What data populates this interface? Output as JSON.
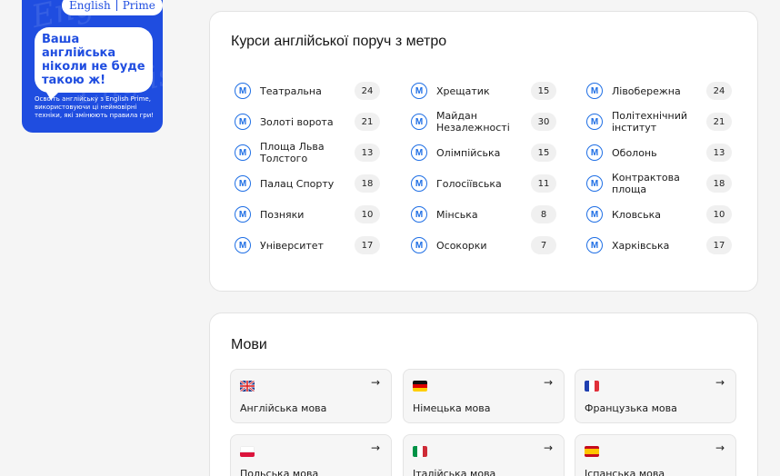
{
  "promo": {
    "logo_left": "English",
    "logo_right": "Prime",
    "headline": "Ваша англійська ніколи не буде такою ж!",
    "subtext": "Освоїть англійську з English Prime, використовуючи ці неймовірні техніки, які змінюють правила гри!",
    "brand_color": "#1f4de0"
  },
  "metro": {
    "title": "Курси англійської поруч з метро",
    "icon_glyph": "M",
    "columns": [
      [
        {
          "name": "Театральна",
          "count": "24"
        },
        {
          "name": "Золоті ворота",
          "count": "21"
        },
        {
          "name": "Площа Льва Толстого",
          "count": "13"
        },
        {
          "name": "Палац Спорту",
          "count": "18"
        },
        {
          "name": "Позняки",
          "count": "10"
        },
        {
          "name": "Університет",
          "count": "17"
        }
      ],
      [
        {
          "name": "Хрещатик",
          "count": "15"
        },
        {
          "name": "Майдан Незалежності",
          "count": "30"
        },
        {
          "name": "Олімпійська",
          "count": "15"
        },
        {
          "name": "Голосіївська",
          "count": "11"
        },
        {
          "name": "Мінська",
          "count": "8"
        },
        {
          "name": "Осокорки",
          "count": "7"
        }
      ],
      [
        {
          "name": "Лівобережна",
          "count": "24"
        },
        {
          "name": "Політехнічний інститут",
          "count": "21"
        },
        {
          "name": "Оболонь",
          "count": "13"
        },
        {
          "name": "Контрактова площа",
          "count": "18"
        },
        {
          "name": "Кловська",
          "count": "10"
        },
        {
          "name": "Харківська",
          "count": "17"
        }
      ]
    ]
  },
  "languages": {
    "title": "Мови",
    "arrow": "→",
    "items": [
      {
        "name": "Англійська мова",
        "flag": "uk-flag-icon"
      },
      {
        "name": "Німецька мова",
        "flag": "germany-flag-icon"
      },
      {
        "name": "Французька мова",
        "flag": "france-flag-icon"
      },
      {
        "name": "Польська мова",
        "flag": "poland-flag-icon"
      },
      {
        "name": "Італійська мова",
        "flag": "italy-flag-icon"
      },
      {
        "name": "Іспанська мова",
        "flag": "spain-flag-icon"
      }
    ]
  }
}
